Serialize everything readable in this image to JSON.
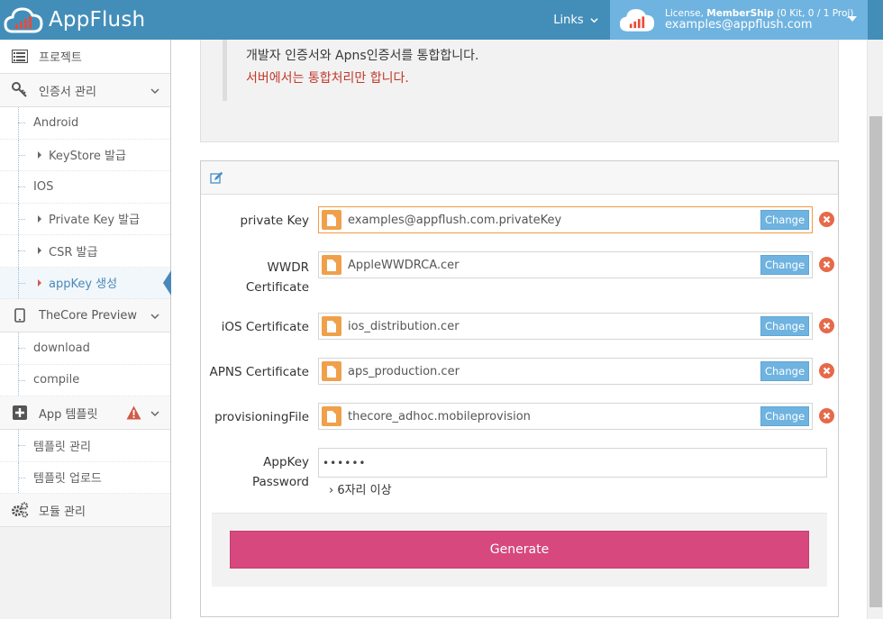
{
  "header": {
    "brand": "AppFlush",
    "links_label": "Links",
    "license_prefix": "License, ",
    "license_plan": "MemberShip",
    "license_suffix": " (0 Kit, 0 / 1 Proj)",
    "email": "examples@appflush.com"
  },
  "sidebar": {
    "project": "프로젝트",
    "cert": "인증서 관리",
    "android": "Android",
    "keystore": "KeyStore 발급",
    "ios": "IOS",
    "privatekey": "Private Key 발급",
    "csr": "CSR 발급",
    "appkey": "appKey 생성",
    "thecore": "TheCore Preview",
    "download": "download",
    "compile": "compile",
    "apptemplate": "App 템플릿",
    "tpl_manage": "템플릿 관리",
    "tpl_upload": "템플릿 업로드",
    "module": "모듈 관리"
  },
  "info": {
    "line1": "개발자 인증서와 Apns인증서를 통합합니다.",
    "line2": "서버에서는 통합처리만 합니다."
  },
  "form": {
    "change_label": "Change",
    "private_key_label": "private Key",
    "private_key_file": "examples@appflush.com.privateKey",
    "wwdr_label_1": "WWDR",
    "wwdr_label_2": "Certificate",
    "wwdr_file": "AppleWWDRCA.cer",
    "ios_label": "iOS Certificate",
    "ios_file": "ios_distribution.cer",
    "apns_label": "APNS Certificate",
    "apns_file": "aps_production.cer",
    "prov_label": "provisioningFile",
    "prov_file": "thecore_adhoc.mobileprovision",
    "appkey_label_1": "AppKey",
    "appkey_label_2": "Password",
    "password_value": "••••••",
    "hint": "› 6자리 이상",
    "generate": "Generate"
  },
  "colors": {
    "header": "#438eb9",
    "user_panel": "#6fb3e0",
    "generate": "#d6487e",
    "remove": "#e66a4a",
    "file_icon": "#f0a04b",
    "warning": "#d15b47"
  }
}
